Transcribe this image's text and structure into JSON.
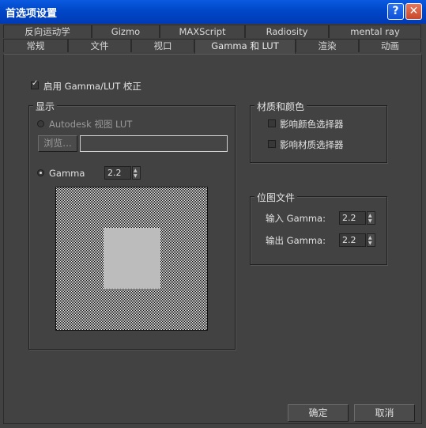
{
  "window": {
    "title": "首选项设置",
    "help_glyph": "?",
    "close_glyph": "✕"
  },
  "tabs_back": [
    "反向运动学",
    "Gizmo",
    "MAXScript",
    "Radiosity",
    "mental ray"
  ],
  "tabs_front": [
    "常规",
    "文件",
    "视口",
    "Gamma 和 LUT",
    "渲染",
    "动画"
  ],
  "active_tab": "Gamma 和 LUT",
  "enable_gamma": {
    "label": "启用 Gamma/LUT 校正",
    "checked": true
  },
  "display": {
    "title": "显示",
    "lut_option": "Autodesk 视图 LUT",
    "browse_label": "浏览...",
    "path_value": "",
    "gamma_option": "Gamma",
    "gamma_value": "2.2"
  },
  "materials": {
    "title": "材质和颜色",
    "affect_color": "影响颜色选择器",
    "affect_material": "影响材质选择器"
  },
  "bitmap": {
    "title": "位图文件",
    "input_label": "输入 Gamma:",
    "input_value": "2.2",
    "output_label": "输出 Gamma:",
    "output_value": "2.2"
  },
  "buttons": {
    "ok": "确定",
    "cancel": "取消"
  },
  "spinner_up": "▲",
  "spinner_down": "▼"
}
